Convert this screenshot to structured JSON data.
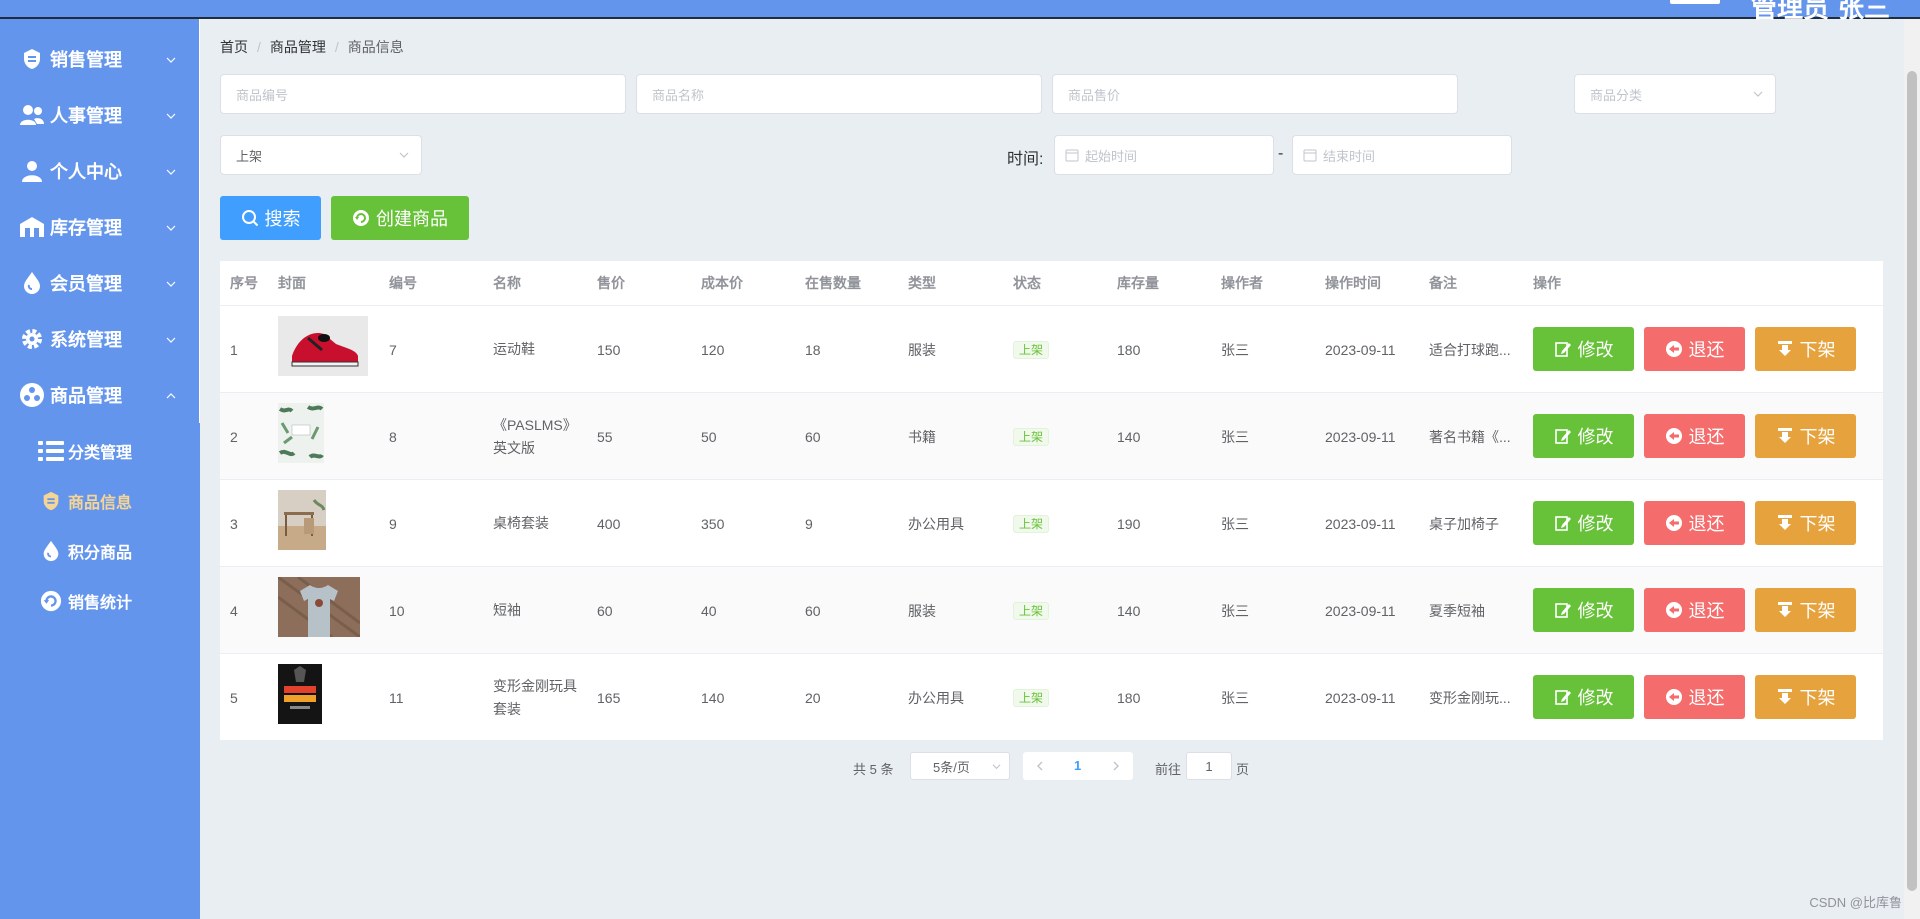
{
  "header": {
    "user_text": "管理员 张三"
  },
  "sidebar": {
    "items": [
      {
        "label": "销售管理",
        "icon": "badge-icon"
      },
      {
        "label": "人事管理",
        "icon": "users-icon"
      },
      {
        "label": "个人中心",
        "icon": "user-icon"
      },
      {
        "label": "库存管理",
        "icon": "warehouse-icon"
      },
      {
        "label": "会员管理",
        "icon": "drop-icon"
      },
      {
        "label": "系统管理",
        "icon": "gear-icon"
      },
      {
        "label": "商品管理",
        "icon": "cluster-icon"
      }
    ],
    "sub_items": [
      {
        "label": "分类管理",
        "icon": "list-icon"
      },
      {
        "label": "商品信息",
        "icon": "badge-icon"
      },
      {
        "label": "积分商品",
        "icon": "drop-icon"
      },
      {
        "label": "销售统计",
        "icon": "refresh-icon"
      }
    ]
  },
  "breadcrumb": [
    "首页",
    "商品管理",
    "商品信息"
  ],
  "filters": {
    "code_placeholder": "商品编号",
    "name_placeholder": "商品名称",
    "price_placeholder": "商品售价",
    "category_placeholder": "商品分类",
    "status_value": "上架",
    "time_label": "时间:",
    "start_placeholder": "起始时间",
    "end_placeholder": "结束时间",
    "dash": "-"
  },
  "actions": {
    "search_label": "搜索",
    "create_label": "创建商品"
  },
  "table": {
    "columns": [
      "序号",
      "封面",
      "编号",
      "名称",
      "售价",
      "成本价",
      "在售数量",
      "类型",
      "状态",
      "库存量",
      "操作者",
      "操作时间",
      "备注",
      "操作"
    ],
    "rows": [
      {
        "index": "1",
        "code": "7",
        "name_1": "运动鞋",
        "name_2": "",
        "price": "150",
        "cost": "120",
        "on_sale": "18",
        "type": "服装",
        "status": "上架",
        "stock": "180",
        "operator": "张三",
        "time": "2023-09-11",
        "note": "适合打球跑..."
      },
      {
        "index": "2",
        "code": "8",
        "name_1": "《PASLMS》",
        "name_2": "英文版",
        "price": "55",
        "cost": "50",
        "on_sale": "60",
        "type": "书籍",
        "status": "上架",
        "stock": "140",
        "operator": "张三",
        "time": "2023-09-11",
        "note": "著名书籍《..."
      },
      {
        "index": "3",
        "code": "9",
        "name_1": "桌椅套装",
        "name_2": "",
        "price": "400",
        "cost": "350",
        "on_sale": "9",
        "type": "办公用具",
        "status": "上架",
        "stock": "190",
        "operator": "张三",
        "time": "2023-09-11",
        "note": "桌子加椅子"
      },
      {
        "index": "4",
        "code": "10",
        "name_1": "短袖",
        "name_2": "",
        "price": "60",
        "cost": "40",
        "on_sale": "60",
        "type": "服装",
        "status": "上架",
        "stock": "140",
        "operator": "张三",
        "time": "2023-09-11",
        "note": "夏季短袖"
      },
      {
        "index": "5",
        "code": "11",
        "name_1": "变形金刚玩具",
        "name_2": "套装",
        "price": "165",
        "cost": "140",
        "on_sale": "20",
        "type": "办公用具",
        "status": "上架",
        "stock": "180",
        "operator": "张三",
        "time": "2023-09-11",
        "note": "变形金刚玩..."
      }
    ],
    "row_actions": {
      "edit": "修改",
      "return": "退还",
      "off_shelf": "下架"
    }
  },
  "pagination": {
    "total": "共 5 条",
    "page_size": "5条/页",
    "current": "1",
    "goto_label": "前往",
    "goto_value": "1",
    "page_label": "页"
  },
  "watermark": "CSDN @比库鲁",
  "colors": {
    "sidebar": "#6495ed",
    "primary": "#409eff",
    "success": "#67c23a",
    "danger": "#f56c6c",
    "warning": "#e6a23c",
    "active_sub": "#f4d596"
  }
}
